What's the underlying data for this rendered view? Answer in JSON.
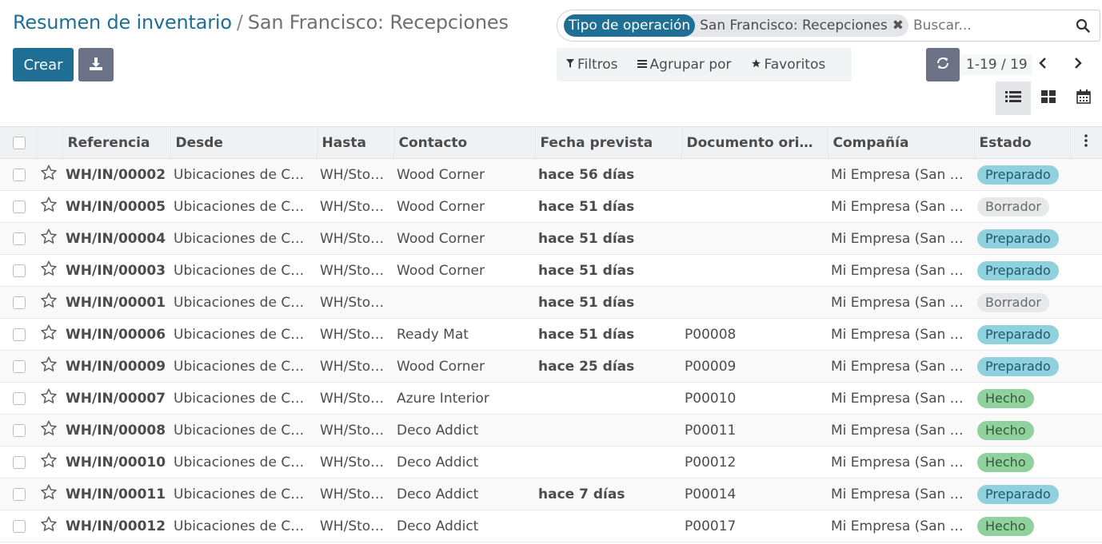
{
  "breadcrumb": {
    "parent": "Resumen de inventario",
    "separator": "/",
    "current": "San Francisco: Recepciones"
  },
  "toolbar": {
    "create_label": "Crear",
    "download_icon": "download-icon"
  },
  "search": {
    "facet_label": "Tipo de operación",
    "facet_value": "San Francisco: Recepciones",
    "facet_close": "✖",
    "placeholder": "Buscar..."
  },
  "filters": {
    "filters_label": "Filtros",
    "groupby_label": "Agrupar por",
    "favorites_label": "Favoritos"
  },
  "pager": {
    "value": "1-19 / 19"
  },
  "colors": {
    "primary": "#1f6f95",
    "late": "#d23f3a",
    "badge_preparado": "#8fd1dd",
    "badge_borrador": "#e7e8ea",
    "badge_hecho": "#8fd29e"
  },
  "table": {
    "headers": [
      "Referencia",
      "Desde",
      "Hasta",
      "Contacto",
      "Fecha prevista",
      "Documento orige…",
      "Compañía",
      "Estado"
    ],
    "rows": [
      {
        "ref": "WH/IN/00002",
        "from": "Ubicaciones de C…",
        "to": "WH/Sto…",
        "contact": "Wood Corner",
        "date": "hace 56 días",
        "origin": "",
        "company": "Mi Empresa (San …",
        "state": "Preparado"
      },
      {
        "ref": "WH/IN/00005",
        "from": "Ubicaciones de C…",
        "to": "WH/Sto…",
        "contact": "Wood Corner",
        "date": "hace 51 días",
        "origin": "",
        "company": "Mi Empresa (San …",
        "state": "Borrador"
      },
      {
        "ref": "WH/IN/00004",
        "from": "Ubicaciones de C…",
        "to": "WH/Sto…",
        "contact": "Wood Corner",
        "date": "hace 51 días",
        "origin": "",
        "company": "Mi Empresa (San …",
        "state": "Preparado"
      },
      {
        "ref": "WH/IN/00003",
        "from": "Ubicaciones de C…",
        "to": "WH/Sto…",
        "contact": "Wood Corner",
        "date": "hace 51 días",
        "origin": "",
        "company": "Mi Empresa (San …",
        "state": "Preparado"
      },
      {
        "ref": "WH/IN/00001",
        "from": "Ubicaciones de C…",
        "to": "WH/Sto…",
        "contact": "",
        "date": "hace 51 días",
        "origin": "",
        "company": "Mi Empresa (San …",
        "state": "Borrador"
      },
      {
        "ref": "WH/IN/00006",
        "from": "Ubicaciones de C…",
        "to": "WH/Sto…",
        "contact": "Ready Mat",
        "date": "hace 51 días",
        "origin": "P00008",
        "company": "Mi Empresa (San …",
        "state": "Preparado"
      },
      {
        "ref": "WH/IN/00009",
        "from": "Ubicaciones de C…",
        "to": "WH/Sto…",
        "contact": "Wood Corner",
        "date": "hace 25 días",
        "origin": "P00009",
        "company": "Mi Empresa (San …",
        "state": "Preparado"
      },
      {
        "ref": "WH/IN/00007",
        "from": "Ubicaciones de C…",
        "to": "WH/Sto…",
        "contact": "Azure Interior",
        "date": "",
        "origin": "P00010",
        "company": "Mi Empresa (San …",
        "state": "Hecho"
      },
      {
        "ref": "WH/IN/00008",
        "from": "Ubicaciones de C…",
        "to": "WH/Sto…",
        "contact": "Deco Addict",
        "date": "",
        "origin": "P00011",
        "company": "Mi Empresa (San …",
        "state": "Hecho"
      },
      {
        "ref": "WH/IN/00010",
        "from": "Ubicaciones de C…",
        "to": "WH/Sto…",
        "contact": "Deco Addict",
        "date": "",
        "origin": "P00012",
        "company": "Mi Empresa (San …",
        "state": "Hecho"
      },
      {
        "ref": "WH/IN/00011",
        "from": "Ubicaciones de C…",
        "to": "WH/Sto…",
        "contact": "Deco Addict",
        "date": "hace 7 días",
        "origin": "P00014",
        "company": "Mi Empresa (San …",
        "state": "Preparado"
      },
      {
        "ref": "WH/IN/00012",
        "from": "Ubicaciones de C…",
        "to": "WH/Sto…",
        "contact": "Deco Addict",
        "date": "",
        "origin": "P00017",
        "company": "Mi Empresa (San …",
        "state": "Hecho"
      }
    ]
  }
}
